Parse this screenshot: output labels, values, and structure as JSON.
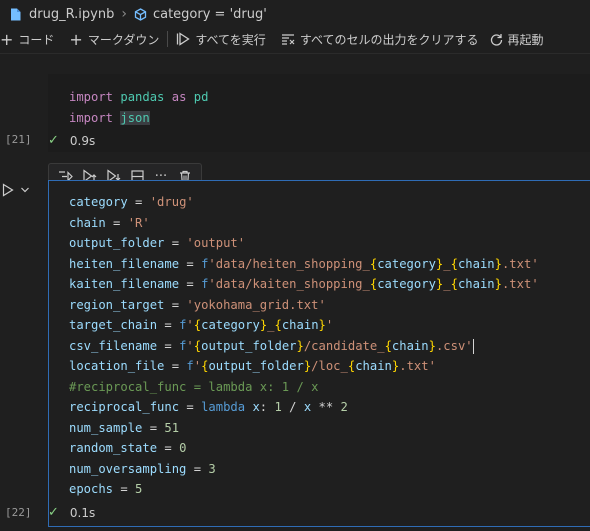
{
  "breadcrumb": {
    "file": "drug_R.ipynb",
    "symbol": "category = 'drug'"
  },
  "toolbar": {
    "add_code": "コード",
    "add_markdown": "マークダウン",
    "run_all": "すべてを実行",
    "clear_outputs": "すべてのセルの出力をクリアする",
    "restart": "再起動"
  },
  "cells": [
    {
      "exec_count": "[21]",
      "status_time": "0.9s"
    },
    {
      "exec_count": "[22]",
      "status_time": "0.1s"
    }
  ],
  "code": {
    "cell1": {
      "l1": {
        "k": "import",
        "m": "pandas",
        "as": "as",
        "alias": "pd"
      },
      "l2": {
        "k": "import",
        "m": "json"
      }
    },
    "cell2": {
      "l1": {
        "v": "category",
        "eq": " = ",
        "s": "'drug'"
      },
      "l2": {
        "v": "chain",
        "eq": " = ",
        "s": "'R'"
      },
      "l3": {
        "v": "output_folder",
        "eq": " = ",
        "s": "'output'"
      },
      "l4": {
        "v": "heiten_filename",
        "eq": " = ",
        "p": "f",
        "s1": "'data/heiten_shopping_",
        "b1": "{",
        "x1": "category",
        "b2": "}",
        "s2": "_",
        "b3": "{",
        "x2": "chain",
        "b4": "}",
        "s3": ".txt'"
      },
      "l5": {
        "v": "kaiten_filename",
        "eq": " = ",
        "p": "f",
        "s1": "'data/kaiten_shopping_",
        "b1": "{",
        "x1": "category",
        "b2": "}",
        "s2": "_",
        "b3": "{",
        "x2": "chain",
        "b4": "}",
        "s3": ".txt'"
      },
      "l6": {
        "v": "region_target",
        "eq": " = ",
        "s": "'yokohama_grid.txt'"
      },
      "l7": {
        "v": "target_chain",
        "eq": " = ",
        "p": "f",
        "s1": "'",
        "b1": "{",
        "x1": "category",
        "b2": "}",
        "s2": "_",
        "b3": "{",
        "x2": "chain",
        "b4": "}",
        "s3": "'"
      },
      "l8": {
        "v": "csv_filename",
        "eq": " = ",
        "p": "f",
        "s1": "'",
        "b1": "{",
        "x1": "output_folder",
        "b2": "}",
        "s2": "/candidate_",
        "b3": "{",
        "x2": "chain",
        "b4": "}",
        "s3": ".csv'"
      },
      "l9": {
        "v": "location_file",
        "eq": " = ",
        "p": "f",
        "s1": "'",
        "b1": "{",
        "x1": "output_folder",
        "b2": "}",
        "s2": "/loc_",
        "b3": "{",
        "x2": "chain",
        "b4": "}",
        "s3": ".txt'"
      },
      "l10": {
        "c": "#reciprocal_func = lambda x: 1 / x"
      },
      "l11": {
        "v": "reciprocal_func",
        "eq": " = ",
        "k": "lambda",
        "x": "x",
        "rest1": ": ",
        "one": "1",
        "div": " / ",
        "x2": "x",
        "pow": " ** ",
        "two": "2"
      },
      "l12": {
        "v": "num_sample",
        "eq": " = ",
        "n": "51"
      },
      "l13": {
        "v": "random_state",
        "eq": " = ",
        "n": "0"
      },
      "l14": {
        "v": "num_oversampling",
        "eq": " = ",
        "n": "3"
      },
      "l15": {
        "v": "epochs",
        "eq": " = ",
        "n": "5"
      }
    }
  },
  "colors": {
    "accent": "#2f6cb5",
    "check": "#89d185"
  }
}
